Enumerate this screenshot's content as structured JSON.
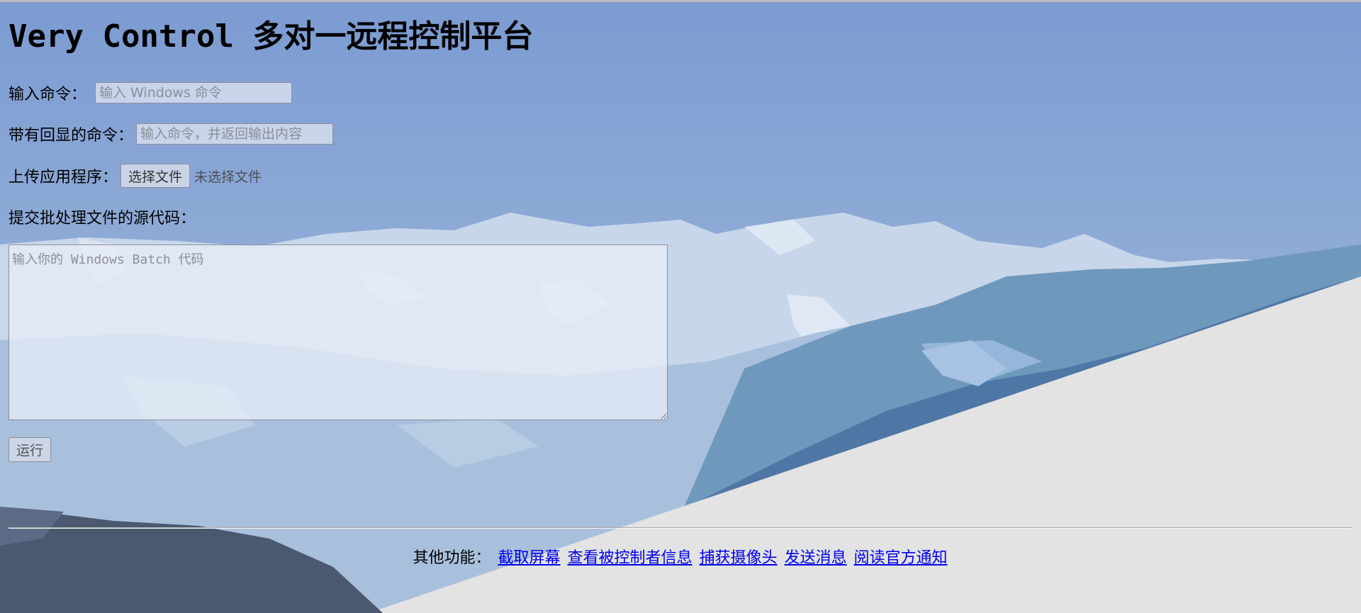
{
  "page": {
    "title": "Very Control 多对一远程控制平台"
  },
  "form": {
    "command": {
      "label": "输入命令：",
      "placeholder": "输入 Windows 命令",
      "value": ""
    },
    "echo_command": {
      "label": "带有回显的命令：",
      "placeholder": "输入命令，并返回输出内容",
      "value": ""
    },
    "upload": {
      "label": "上传应用程序：",
      "button_label": "选择文件",
      "status": "未选择文件"
    },
    "batch": {
      "label": "提交批处理文件的源代码：",
      "placeholder": "输入你的 Windows Batch 代码",
      "value": ""
    },
    "run_label": "运行"
  },
  "footer": {
    "prefix": "其他功能：",
    "links": [
      {
        "label": "截取屏幕"
      },
      {
        "label": "查看被控制者信息"
      },
      {
        "label": "捕获摄像头"
      },
      {
        "label": "发送消息"
      },
      {
        "label": "阅读官方通知"
      }
    ]
  },
  "colors": {
    "sky": "#7b9bd2",
    "mountain_light": "#c5d5ea",
    "mountain_mid": "#6f98bd",
    "mountain_dark": "#4f77a6",
    "foreground_rock": "#4a5870",
    "page_background": "#e3e3e3",
    "link": "#0000ee"
  },
  "background": {
    "icon": "mountain-landscape-icon"
  }
}
